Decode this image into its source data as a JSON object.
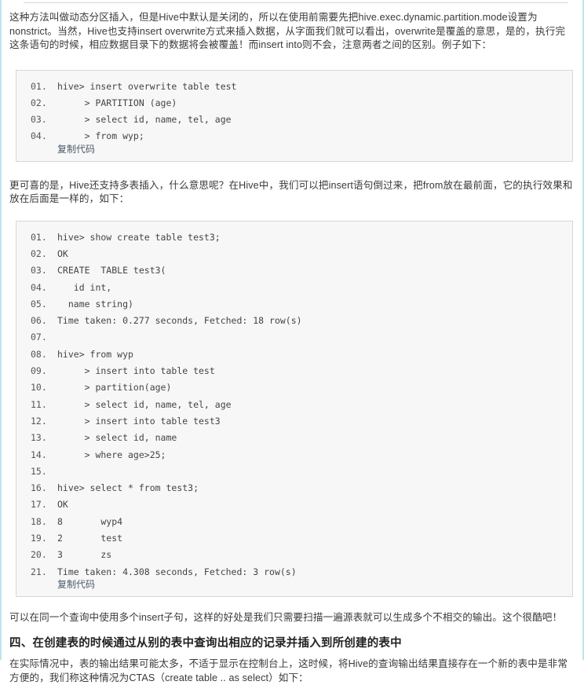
{
  "page": {
    "top_rule": true,
    "border_color": "#bfe3f2",
    "code_bg": "#f7f7f7",
    "code_border": "#d7d7d7",
    "copy_link_color": "#4a5a6a"
  },
  "paragraphs": {
    "intro": "这种方法叫做动态分区插入，但是Hive中默认是关闭的，所以在使用前需要先把hive.exec.dynamic.partition.mode设置为nonstrict。当然，Hive也支持insert overwrite方式来插入数据，从字面我们就可以看出，overwrite是覆盖的意思，是的，执行完这条语句的时候，相应数据目录下的数据将会被覆盖！而insert into则不会，注意两者之间的区别。例子如下：",
    "multi_insert": "更可喜的是，Hive还支持多表插入，什么意思呢？在Hive中，我们可以把insert语句倒过来，把from放在最前面，它的执行效果和放在后面是一样的，如下：",
    "after_second_code": "可以在同一个查询中使用多个insert子句，这样的好处是我们只需要扫描一遍源表就可以生成多个不相交的输出。这个很酷吧！",
    "ctas": "在实际情况中，表的输出结果可能太多，不适于显示在控制台上，这时候，将Hive的查询输出结果直接存在一个新的表中是非常方便的，我们称这种情况为CTAS（create table .. as select）如下："
  },
  "heading": {
    "section4": "四、在创建表的时候通过从别的表中查询出相应的记录并插入到所创建的表中"
  },
  "code_blocks": [
    {
      "id": "insert-overwrite-example",
      "copy_label": "复制代码",
      "lines": [
        {
          "no": "01.",
          "text": "hive> insert overwrite table test"
        },
        {
          "no": "02.",
          "text": "     > PARTITION (age)"
        },
        {
          "no": "03.",
          "text": "     > select id, name, tel, age"
        },
        {
          "no": "04.",
          "text": "     > from wyp;"
        }
      ]
    },
    {
      "id": "multi-insert-example",
      "copy_label": "复制代码",
      "lines": [
        {
          "no": "01.",
          "text": "hive> show create table test3;"
        },
        {
          "no": "02.",
          "text": "OK"
        },
        {
          "no": "03.",
          "text": "CREATE  TABLE test3("
        },
        {
          "no": "04.",
          "text": "   id int,"
        },
        {
          "no": "05.",
          "text": "  name string)"
        },
        {
          "no": "06.",
          "text": "Time taken: 0.277 seconds, Fetched: 18 row(s)"
        },
        {
          "no": "07.",
          "text": ""
        },
        {
          "no": "08.",
          "text": "hive> from wyp"
        },
        {
          "no": "09.",
          "text": "     > insert into table test"
        },
        {
          "no": "10.",
          "text": "     > partition(age)"
        },
        {
          "no": "11.",
          "text": "     > select id, name, tel, age"
        },
        {
          "no": "12.",
          "text": "     > insert into table test3"
        },
        {
          "no": "13.",
          "text": "     > select id, name"
        },
        {
          "no": "14.",
          "text": "     > where age>25;"
        },
        {
          "no": "15.",
          "text": ""
        },
        {
          "no": "16.",
          "text": "hive> select * from test3;"
        },
        {
          "no": "17.",
          "text": "OK"
        },
        {
          "no": "18.",
          "text": "8       wyp4"
        },
        {
          "no": "19.",
          "text": "2       test"
        },
        {
          "no": "20.",
          "text": "3       zs"
        },
        {
          "no": "21.",
          "text": "Time taken: 4.308 seconds, Fetched: 3 row(s)"
        }
      ]
    }
  ]
}
